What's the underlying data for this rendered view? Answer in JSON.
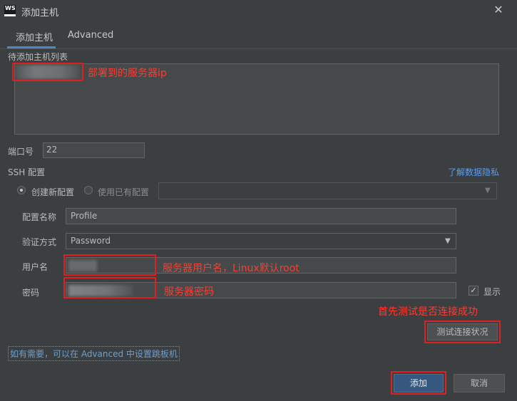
{
  "window": {
    "title": "添加主机",
    "app_logo_text": "WS",
    "close_symbol": "✕"
  },
  "tabs": [
    {
      "label": "添加主机",
      "active": true
    },
    {
      "label": "Advanced",
      "active": false
    }
  ],
  "host_list": {
    "label": "待添加主机列表",
    "annotation": "部署到的服务器ip"
  },
  "port": {
    "label": "端口号",
    "value": "22"
  },
  "ssh": {
    "label": "SSH 配置",
    "privacy_link": "了解数据隐私",
    "radio_new": "创建新配置",
    "radio_existing": "使用已有配置",
    "selected": "创建新配置"
  },
  "form": {
    "config_name_label": "配置名称",
    "config_name_value": "Profile",
    "auth_label": "验证方式",
    "auth_value": "Password",
    "username_label": "用户名",
    "username_annotation": "服务器用户名，Linux默认root",
    "password_label": "密码",
    "password_annotation": "服务器密码",
    "show_label": "显示",
    "show_checked": true
  },
  "test": {
    "annotation": "首先测试是否连接成功",
    "button": "测试连接状况"
  },
  "jump_hint": "如有需要，可以在 Advanced 中设置跳板机",
  "footer": {
    "add_button": "添加",
    "cancel_button": "取消"
  },
  "colors": {
    "background": "#3c3f41",
    "accent": "#365880",
    "annotation_red": "#e02020",
    "link": "#589df6"
  }
}
